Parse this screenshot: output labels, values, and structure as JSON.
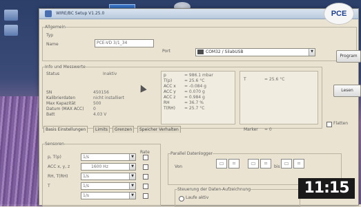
{
  "window": {
    "title": "WIRE/BC Setup V1.25.0"
  },
  "brand": {
    "logo_text": "PCE"
  },
  "device": {
    "section_label": "Allgemein",
    "type_label": "Typ",
    "name_label": "Name",
    "name_value": "PCE-VD 3/1_34",
    "port_label": "Port",
    "port_value": "COM32 / SilabUSB",
    "prog_button": "Program"
  },
  "info": {
    "section_label": "Info und Messwerte",
    "status_label": "Status",
    "status_value": "Inaktiv",
    "sn_label": "SN",
    "sn_value": "450156",
    "kalibrierdaten_label": "Kalibrierdaten",
    "kalibrierdaten_value": "nicht installiert",
    "speicher_label": "Max Kapazität",
    "speicher_value": "500",
    "datum_label": "Datum (MAX ACC)",
    "datum_value": "0",
    "batt_label": "Batt",
    "batt_value": "4.03 V"
  },
  "readings": {
    "p_label": "p",
    "p_value": "= 986.1 mbar",
    "tp_label": "T(p)",
    "tp_value": "= 25.6 °C",
    "accx_label": "ACC x",
    "accx_value": "= -0.084 g",
    "accy_label": "ACC y",
    "accy_value": "= 0.070 g",
    "accz_label": "ACC z",
    "accz_value": "= 0.984 g",
    "rh_label": "RH",
    "rh_value": "= 36.7 %",
    "trh_label": "T(RH)",
    "trh_value": "= 25.7 °C",
    "t_label": "T",
    "t_value": "= 25.6 °C",
    "lesen_button": "Lesen",
    "marker_label": "Marker",
    "marker_value": "= 0",
    "flatten_label": "Flatten"
  },
  "tabs": [
    {
      "label": "Basis Einstellungen"
    },
    {
      "label": "Limits"
    },
    {
      "label": "Grenzen"
    },
    {
      "label": "Speicher Verhalten"
    }
  ],
  "sensor": {
    "section_label": "Sensoren",
    "rate_label": "Rate",
    "row1_label": "p, T(p)",
    "row1_value": "1/s",
    "row2_label": "ACC x, y, z",
    "row2_value": "1600 Hz",
    "row3_label": "RH, T(RH)",
    "row3_value": "1/s",
    "row4_label": "T",
    "row4_value": "1/s",
    "row5_value": "1/s"
  },
  "interval": {
    "section_label": "Parallel Datenlogger",
    "start_label": "Von",
    "end_label": "bis",
    "plan_label": "Steuerung der Daten-Aufzeichnung",
    "plan_option": "Laufe aktiv"
  },
  "overlay": {
    "time": "11:15"
  }
}
